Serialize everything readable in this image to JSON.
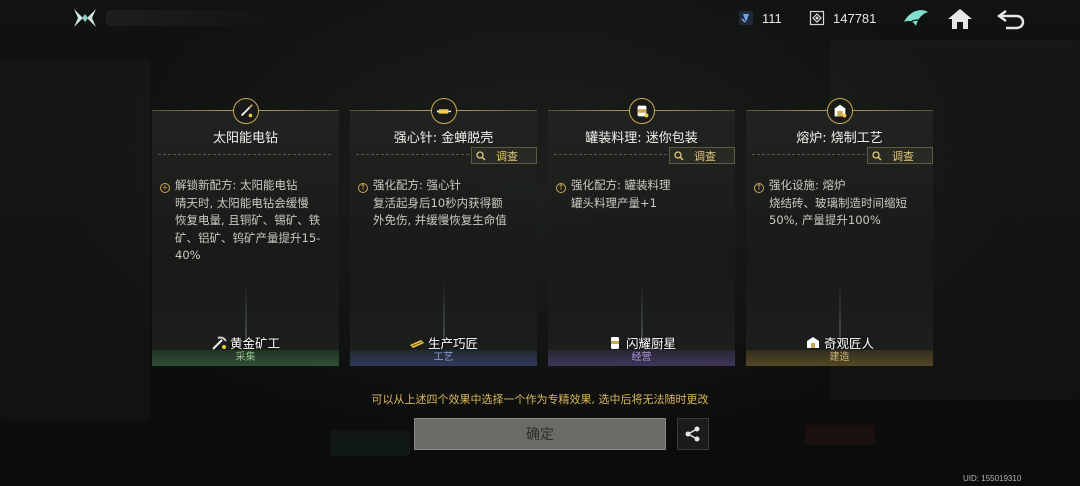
{
  "top_bar": {
    "gem_count": "111",
    "coin_count": "147781",
    "icons": [
      "logo-icon",
      "gem-icon",
      "coin-icon",
      "wing-icon",
      "home-icon",
      "back-icon"
    ]
  },
  "cards": [
    {
      "title": "太阳能电钻",
      "effect_lines": [
        "解锁新配方: 太阳能电钻",
        "晴天时, 太阳能电钻会缓慢",
        "恢复电量, 且铜矿、锡矿、铁",
        "矿、铝矿、钨矿产量提升15-",
        "40%"
      ],
      "badge": "黄金矿工",
      "category": "采集",
      "has_investigate": false
    },
    {
      "title": "强心针: 金蝉脱壳",
      "effect_lines": [
        "强化配方: 强心针",
        "复活起身后10秒内获得额",
        "外免伤, 并缓慢恢复生命值"
      ],
      "badge": "生产巧匠",
      "category": "工艺",
      "has_investigate": true
    },
    {
      "title": "罐装料理: 迷你包装",
      "effect_lines": [
        "强化配方: 罐装料理",
        "罐头料理产量+1"
      ],
      "badge": "闪耀厨星",
      "category": "经营",
      "has_investigate": true
    },
    {
      "title": "熔炉: 烧制工艺",
      "effect_lines": [
        "强化设施: 熔炉",
        "烧结砖、玻璃制造时间缩短",
        "50%, 产量提升100%"
      ],
      "badge": "奇观匠人",
      "category": "建造",
      "has_investigate": true
    }
  ],
  "investigate_label": "调查",
  "hint": "可以从上述四个效果中选择一个作为专精效果, 选中后将无法随时更改",
  "confirm_label": "确定",
  "uid": "UID: 155019310",
  "colors": {
    "gold": "#d9b75c",
    "confirm_bg": "#6a6a67"
  }
}
